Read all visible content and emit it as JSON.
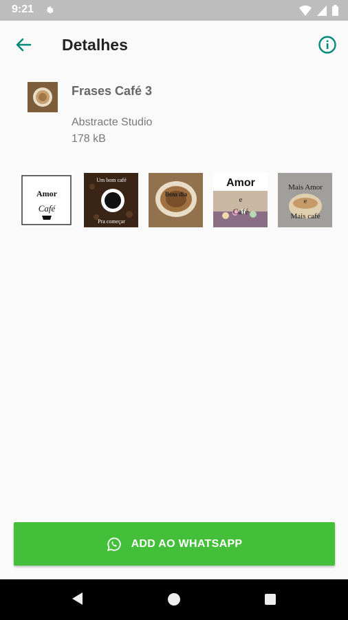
{
  "status_bar": {
    "time": "9:21"
  },
  "app_bar": {
    "title": "Detalhes"
  },
  "pack": {
    "name": "Frases Café 3",
    "publisher": "Abstracte Studio",
    "size": "178 kB"
  },
  "stickers": [
    {
      "lines": [
        "Amor",
        "Café"
      ]
    },
    {
      "lines": [
        "Um bom café",
        "Pra começar"
      ]
    },
    {
      "lines": [
        "Bom dia"
      ]
    },
    {
      "lines": [
        "Amor",
        "e",
        "Café"
      ]
    },
    {
      "lines": [
        "Mais Amor",
        "e",
        "Mais café"
      ]
    }
  ],
  "actions": {
    "add_label": "ADD AO WHATSAPP"
  },
  "colors": {
    "accent": "#00897b",
    "whatsapp_green": "#43bf3a",
    "status_bar": "#bdbdbd"
  }
}
